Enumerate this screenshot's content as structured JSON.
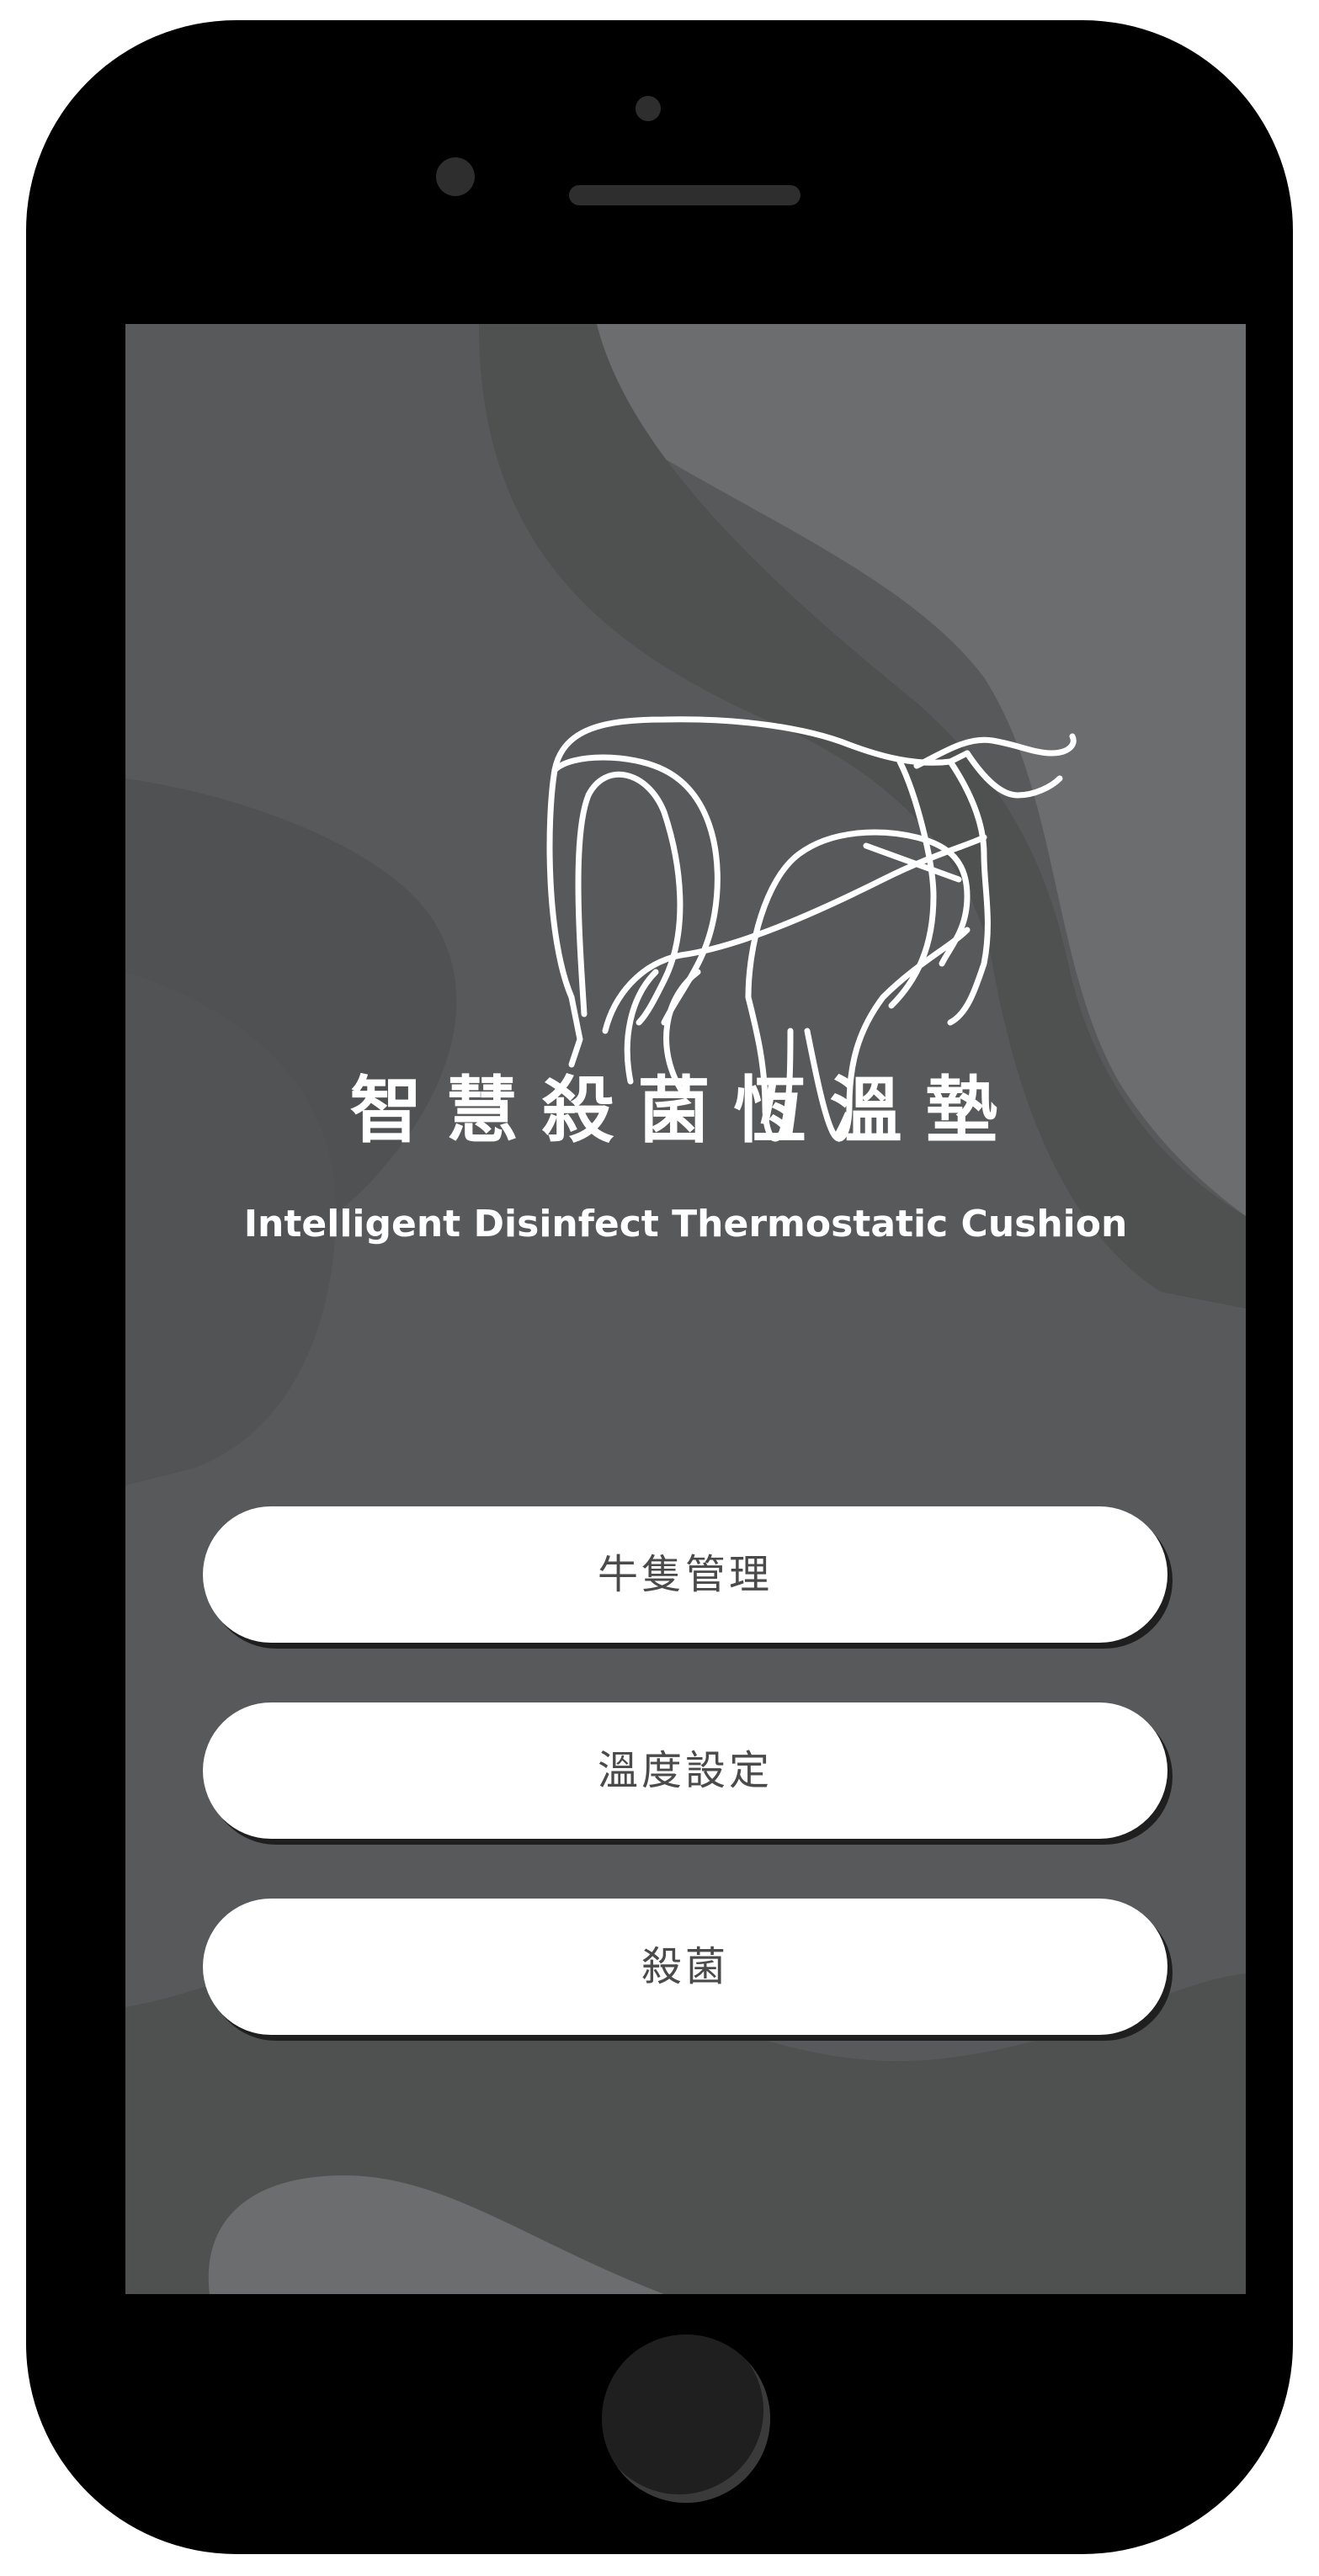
{
  "app": {
    "title_zh": "智慧殺菌恆溫墊",
    "title_en": "Intelligent Disinfect Thermostatic Cushion"
  },
  "menu": {
    "items": [
      {
        "label": "牛隻管理",
        "icon": "none"
      },
      {
        "label": "溫度設定",
        "icon": "none"
      },
      {
        "label": "殺菌",
        "icon": "none"
      }
    ]
  },
  "device": {
    "frame_color": "#000000",
    "screen_background": "#58595a",
    "logo": "cow-line-art-icon"
  },
  "colors": {
    "button_background": "#ffffff",
    "button_text": "#4a4a4a",
    "title_text": "#ffffff",
    "wave_light": "#6c6d6f",
    "wave_dark": "#4f5050"
  }
}
